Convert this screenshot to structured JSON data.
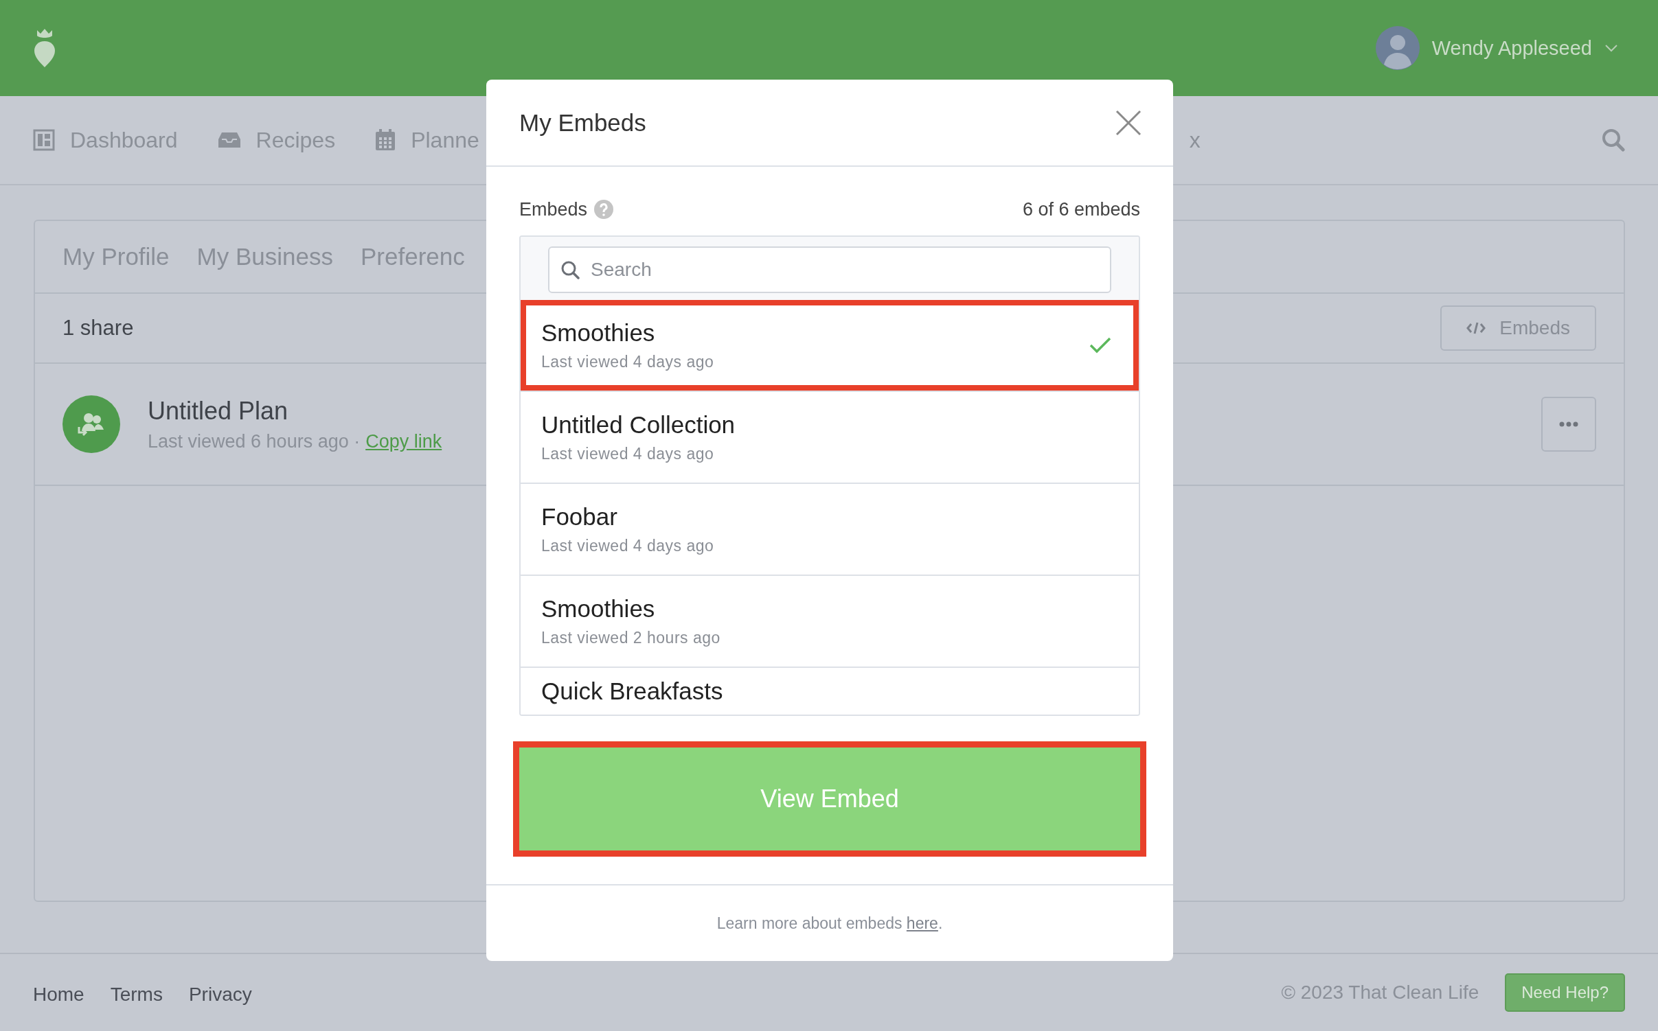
{
  "header": {
    "user_name": "Wendy Appleseed"
  },
  "nav": {
    "items": [
      {
        "label": "Dashboard",
        "kind": "dashboard"
      },
      {
        "label": "Recipes",
        "kind": "recipes"
      },
      {
        "label": "Planne",
        "kind": "planner"
      }
    ],
    "trailing": "x"
  },
  "profile_tabs": [
    {
      "label": "My Profile"
    },
    {
      "label": "My Business"
    },
    {
      "label": "Preferenc"
    }
  ],
  "shares": {
    "count": "1 share",
    "embeds_button": "Embeds",
    "rows": [
      {
        "title": "Untitled Plan",
        "meta": "Last viewed 6 hours ago ·",
        "link": "Copy link"
      }
    ]
  },
  "modal": {
    "title": "My Embeds",
    "label": "Embeds",
    "count": "6 of 6 embeds",
    "search": {
      "placeholder": "Search"
    },
    "items": [
      {
        "title": "Smoothies",
        "meta": "Last viewed 4 days ago",
        "selected": true,
        "highlighted": true
      },
      {
        "title": "Untitled Collection",
        "meta": "Last viewed 4 days ago",
        "selected": false,
        "highlighted": false
      },
      {
        "title": "Foobar",
        "meta": "Last viewed 4 days ago",
        "selected": false,
        "highlighted": false
      },
      {
        "title": "Smoothies",
        "meta": "Last viewed 2 hours ago",
        "selected": false,
        "highlighted": false
      },
      {
        "title": "Quick Breakfasts",
        "selected": false,
        "highlighted": false
      }
    ],
    "action": {
      "label": "View Embed",
      "highlighted": true
    },
    "note": {
      "text": "Learn more about embeds",
      "link": "here",
      "end": "."
    }
  },
  "footer": {
    "links": [
      "Home",
      "Terms",
      "Privacy"
    ],
    "copyright": "© 2023 That Clean Life",
    "help_button": "Need Help?"
  }
}
